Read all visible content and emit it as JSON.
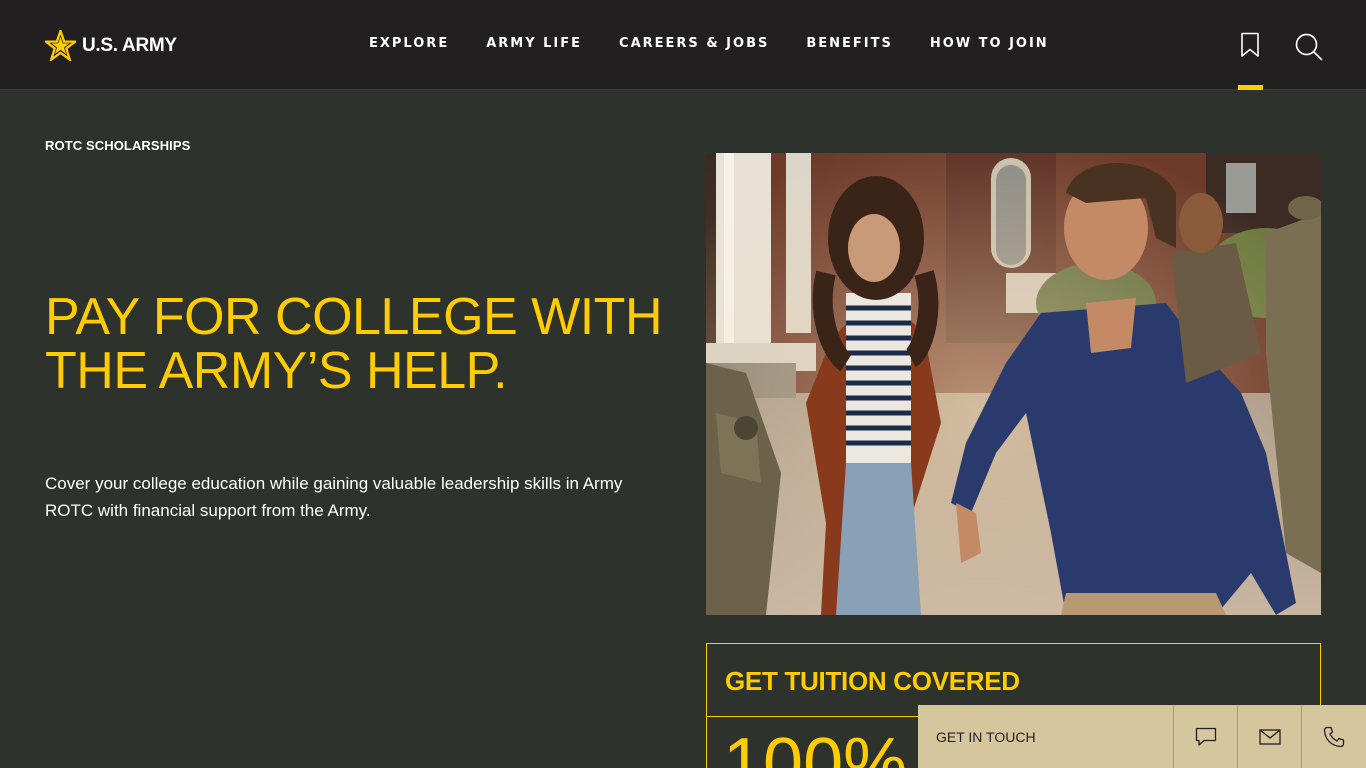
{
  "header": {
    "logo_text": "U.S. ARMY",
    "nav": [
      "EXPLORE",
      "ARMY LIFE",
      "CAREERS & JOBS",
      "BENEFITS",
      "HOW TO JOIN"
    ],
    "icons": [
      "bookmark-icon",
      "search-icon"
    ]
  },
  "hero": {
    "eyebrow": "ROTC SCHOLARSHIPS",
    "headline": "PAY FOR COLLEGE WITH THE ARMY’S HELP.",
    "subtext": "Cover your college education while gaining valuable leadership skills in Army ROTC with financial support from the Army."
  },
  "card": {
    "title": "GET TUITION COVERED",
    "big_value": "100%"
  },
  "contact": {
    "label": "GET IN TOUCH",
    "icons": [
      "chat-icon",
      "mail-icon",
      "phone-icon"
    ]
  },
  "colors": {
    "accent": "#ffcc01",
    "header_bg": "#221f20",
    "page_bg": "#2d322c",
    "contact_bg": "#d6c69e"
  }
}
